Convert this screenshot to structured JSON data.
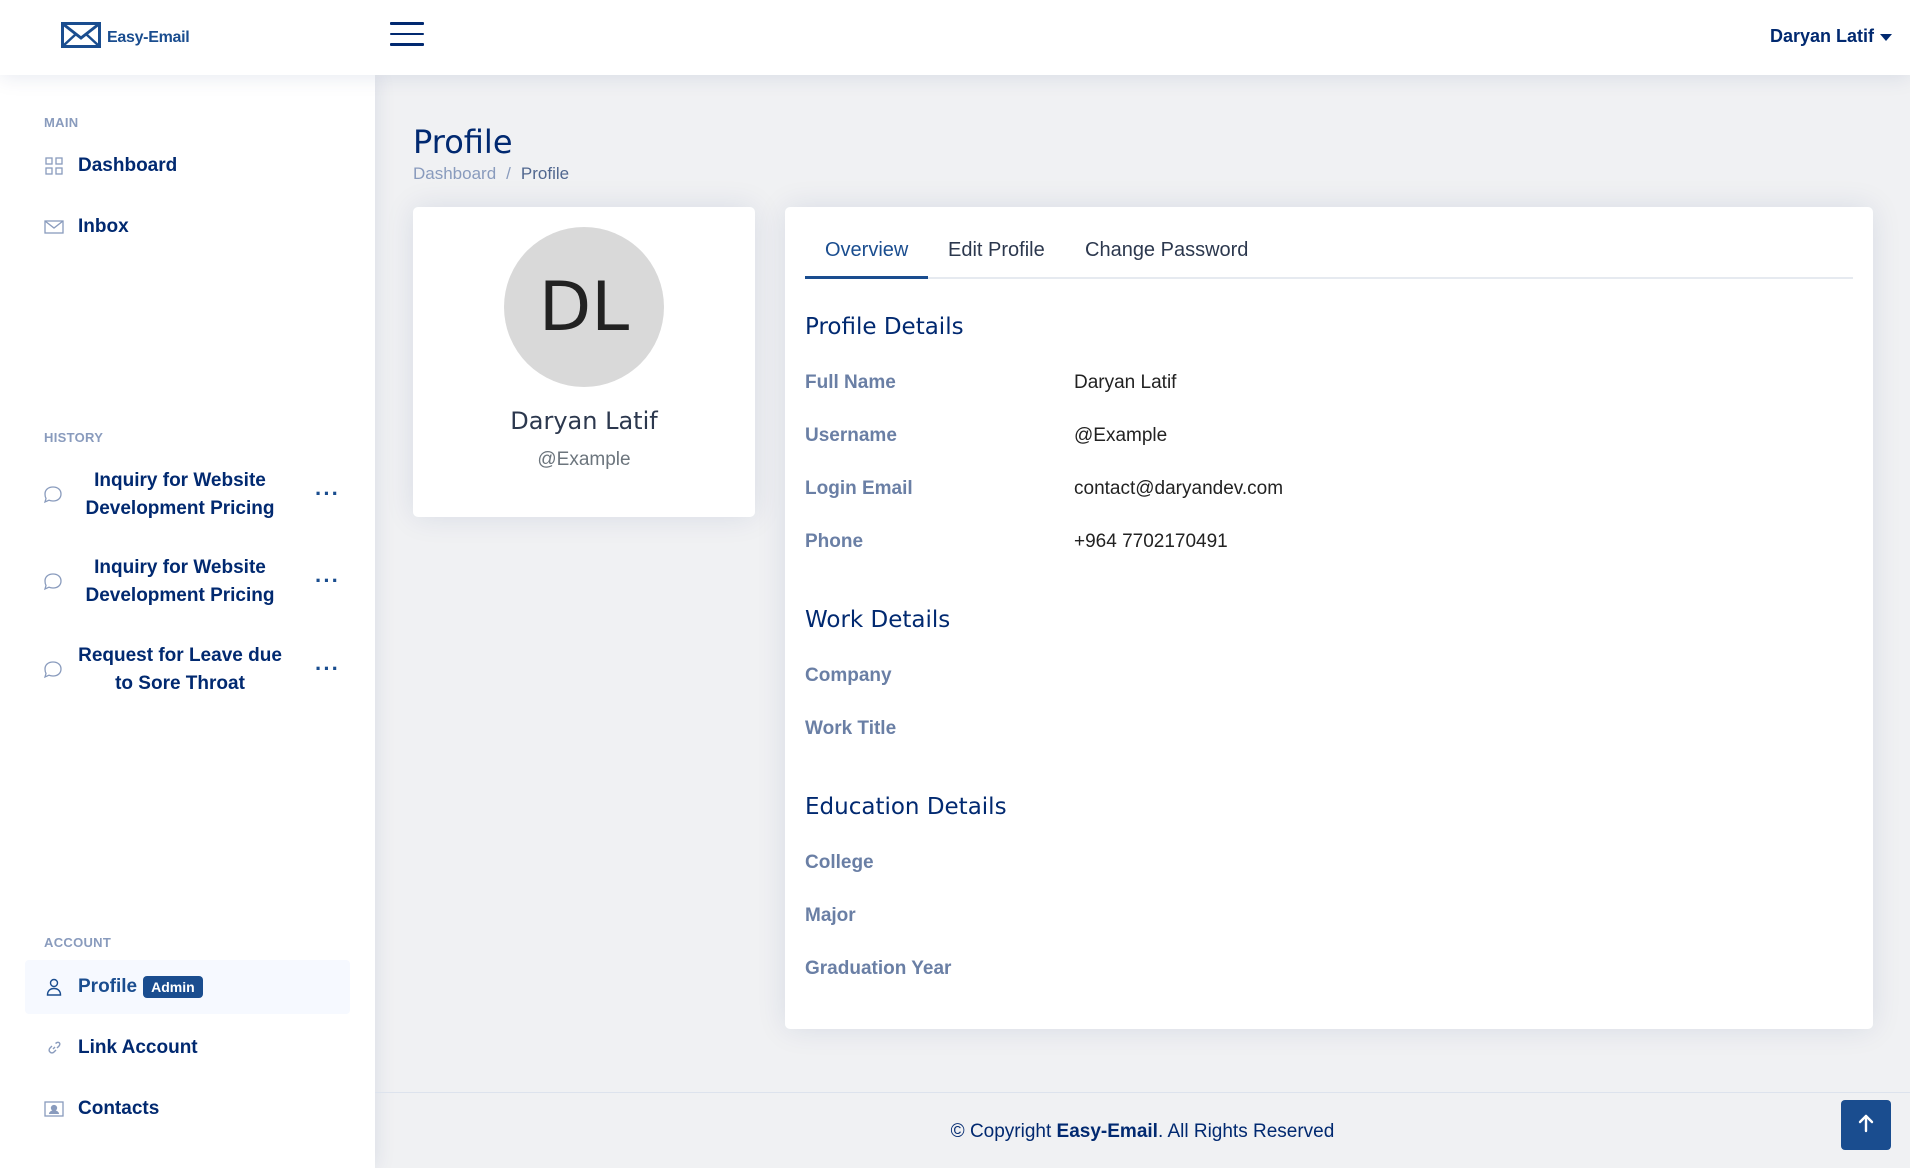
{
  "header": {
    "logo_text": "Easy-Email",
    "user_name": "Daryan Latif"
  },
  "sidebar": {
    "main_heading": "MAIN",
    "main_items": [
      {
        "label": "Dashboard",
        "icon": "grid-icon"
      },
      {
        "label": "Inbox",
        "icon": "envelope-icon"
      }
    ],
    "history_heading": "HISTORY",
    "history_items": [
      {
        "title": "Inquiry for Website Development Pricing"
      },
      {
        "title": "Inquiry for Website Development Pricing"
      },
      {
        "title": "Request for Leave due to Sore Throat"
      }
    ],
    "more_label": "···",
    "account_heading": "ACCOUNT",
    "account_items": [
      {
        "label": "Profile",
        "badge": "Admin",
        "icon": "person-icon",
        "active": true
      },
      {
        "label": "Link Account",
        "icon": "link-icon"
      },
      {
        "label": "Contacts",
        "icon": "contact-card-icon"
      }
    ]
  },
  "page": {
    "title": "Profile",
    "breadcrumb": [
      "Dashboard",
      "/",
      "Profile"
    ]
  },
  "profile_card": {
    "initials": "DL",
    "name": "Daryan Latif",
    "handle": "@Example"
  },
  "tabs": [
    "Overview",
    "Edit Profile",
    "Change Password"
  ],
  "profile_details": {
    "title": "Profile Details",
    "rows": [
      {
        "label": "Full Name",
        "value": "Daryan Latif"
      },
      {
        "label": "Username",
        "value": "@Example"
      },
      {
        "label": "Login Email",
        "value": "contact@daryandev.com"
      },
      {
        "label": "Phone",
        "value": "+964 7702170491"
      }
    ]
  },
  "work_details": {
    "title": "Work Details",
    "rows": [
      {
        "label": "Company",
        "value": ""
      },
      {
        "label": "Work Title",
        "value": ""
      }
    ]
  },
  "education_details": {
    "title": "Education Details",
    "rows": [
      {
        "label": "College",
        "value": ""
      },
      {
        "label": "Major",
        "value": ""
      },
      {
        "label": "Graduation Year",
        "value": ""
      }
    ]
  },
  "footer": {
    "prefix": "© Copyright ",
    "brand": "Easy-Email",
    "suffix": ". All Rights Reserved"
  },
  "colors": {
    "accent": "#1a4d8f",
    "navy": "#012970",
    "muted": "#899bbd",
    "background": "#f0f1f3"
  }
}
